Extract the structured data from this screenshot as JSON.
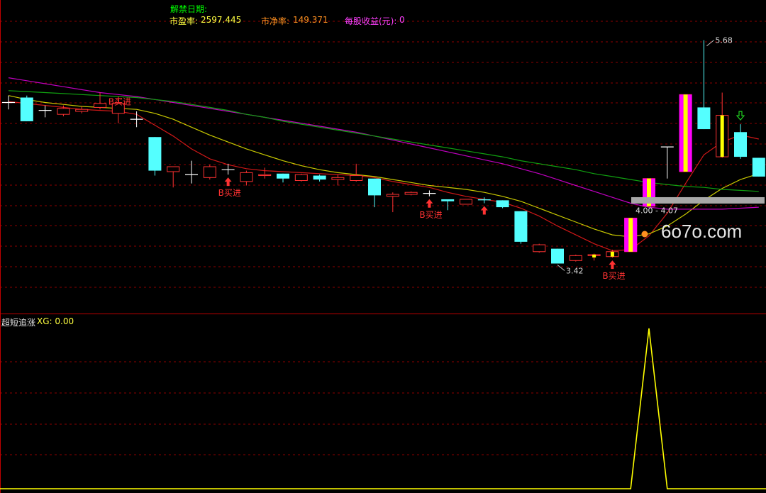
{
  "header": {
    "unlock_date_label": "解禁日期:",
    "pe_label": "市盈率:",
    "pe_value": "2597.445",
    "pb_label": "市净率:",
    "pb_value": "149.371",
    "eps_label": "每股收益(元):",
    "eps_value": "0"
  },
  "indicator": {
    "name": "超短追涨",
    "xg_label": "XG: 0.00"
  },
  "annotations": {
    "high_label": "5.68",
    "low_label": "3.42",
    "range_label": "4.00 - 4.07",
    "buy_label": "B买进"
  },
  "watermark": "6o7o.com",
  "colors": {
    "bg": "#000000",
    "grid": "#8c0000",
    "up_candle": "#ff3232",
    "down_candle": "#54ffff",
    "ma_red": "#d01818",
    "ma_yellow": "#c8c800",
    "ma_magenta": "#c000c0",
    "ma_green": "#10a010",
    "signal_magenta": "#ff00ff",
    "signal_yellow": "#ffff00",
    "buy_text": "#ff3232",
    "label_green": "#00ff00",
    "label_yellow": "#ffff40",
    "label_orange": "#ff9020",
    "label_magenta": "#ff40ff"
  },
  "chart_data": [
    {
      "type": "candlestick",
      "title": "",
      "ylim": [
        3.0,
        5.8
      ],
      "candles": [
        {
          "o": 5.05,
          "c": 5.05,
          "h": 5.12,
          "l": 4.98,
          "dir": "flat"
        },
        {
          "o": 5.1,
          "c": 4.86,
          "h": 5.12,
          "l": 4.86,
          "dir": "down"
        },
        {
          "o": 4.97,
          "c": 4.97,
          "h": 5.02,
          "l": 4.9,
          "dir": "flat"
        },
        {
          "o": 4.93,
          "c": 4.99,
          "h": 5.02,
          "l": 4.91,
          "dir": "up"
        },
        {
          "o": 4.96,
          "c": 4.98,
          "h": 5.01,
          "l": 4.94,
          "dir": "up"
        },
        {
          "o": 5.0,
          "c": 5.04,
          "h": 5.15,
          "l": 4.98,
          "dir": "up"
        },
        {
          "o": 4.94,
          "c": 5.04,
          "h": 5.11,
          "l": 4.84,
          "dir": "up"
        },
        {
          "o": 4.88,
          "c": 4.88,
          "h": 4.96,
          "l": 4.8,
          "dir": "flat"
        },
        {
          "o": 4.7,
          "c": 4.36,
          "h": 4.7,
          "l": 4.31,
          "dir": "down"
        },
        {
          "o": 4.35,
          "c": 4.4,
          "h": 4.4,
          "l": 4.19,
          "dir": "up"
        },
        {
          "o": 4.32,
          "c": 4.32,
          "h": 4.46,
          "l": 4.23,
          "dir": "flat"
        },
        {
          "o": 4.29,
          "c": 4.4,
          "h": 4.42,
          "l": 4.27,
          "dir": "up"
        },
        {
          "o": 4.37,
          "c": 4.37,
          "h": 4.43,
          "l": 4.32,
          "dir": "flat"
        },
        {
          "o": 4.25,
          "c": 4.34,
          "h": 4.36,
          "l": 4.21,
          "dir": "up"
        },
        {
          "o": 4.31,
          "c": 4.32,
          "h": 4.39,
          "l": 4.28,
          "dir": "up"
        },
        {
          "o": 4.33,
          "c": 4.28,
          "h": 4.33,
          "l": 4.24,
          "dir": "down"
        },
        {
          "o": 4.26,
          "c": 4.32,
          "h": 4.33,
          "l": 4.25,
          "dir": "up"
        },
        {
          "o": 4.31,
          "c": 4.27,
          "h": 4.32,
          "l": 4.25,
          "dir": "down"
        },
        {
          "o": 4.27,
          "c": 4.29,
          "h": 4.32,
          "l": 4.21,
          "dir": "up"
        },
        {
          "o": 4.26,
          "c": 4.31,
          "h": 4.43,
          "l": 4.25,
          "dir": "up"
        },
        {
          "o": 4.28,
          "c": 4.11,
          "h": 4.28,
          "l": 3.99,
          "dir": "down"
        },
        {
          "o": 4.1,
          "c": 4.12,
          "h": 4.14,
          "l": 3.94,
          "dir": "up"
        },
        {
          "o": 4.12,
          "c": 4.14,
          "h": 4.15,
          "l": 4.11,
          "dir": "up"
        },
        {
          "o": 4.13,
          "c": 4.13,
          "h": 4.16,
          "l": 4.1,
          "dir": "flat"
        },
        {
          "o": 4.07,
          "c": 4.05,
          "h": 4.07,
          "l": 3.96,
          "dir": "down"
        },
        {
          "o": 4.02,
          "c": 4.07,
          "h": 4.07,
          "l": 4.02,
          "dir": "up"
        },
        {
          "o": 4.07,
          "c": 4.06,
          "h": 4.09,
          "l": 4.03,
          "dir": "down"
        },
        {
          "o": 4.06,
          "c": 3.99,
          "h": 4.06,
          "l": 3.98,
          "dir": "down"
        },
        {
          "o": 3.95,
          "c": 3.64,
          "h": 3.95,
          "l": 3.62,
          "dir": "down"
        },
        {
          "o": 3.54,
          "c": 3.61,
          "h": 3.62,
          "l": 3.53,
          "dir": "up"
        },
        {
          "o": 3.57,
          "c": 3.42,
          "h": 3.57,
          "l": 3.42,
          "dir": "down"
        },
        {
          "o": 3.45,
          "c": 3.5,
          "h": 3.51,
          "l": 3.44,
          "dir": "up"
        },
        {
          "o": 3.5,
          "c": 3.51,
          "h": 3.52,
          "l": 3.45,
          "dir": "up",
          "sig": "yellow"
        },
        {
          "o": 3.49,
          "c": 3.54,
          "h": 3.56,
          "l": 3.48,
          "dir": "up",
          "sig": "yellow"
        },
        {
          "o": 3.54,
          "c": 3.88,
          "h": 3.88,
          "l": 3.54,
          "dir": "up",
          "sig": "magenta"
        },
        {
          "o": 4.0,
          "c": 4.28,
          "h": 4.28,
          "l": 4.0,
          "dir": "up",
          "sig": "magenta"
        },
        {
          "o": 4.6,
          "c": 4.6,
          "h": 4.6,
          "l": 4.28,
          "dir": "flat"
        },
        {
          "o": 4.35,
          "c": 5.13,
          "h": 5.13,
          "l": 4.35,
          "dir": "up",
          "sig": "magenta"
        },
        {
          "o": 5.0,
          "c": 4.78,
          "h": 5.68,
          "l": 4.78,
          "dir": "down"
        },
        {
          "o": 4.92,
          "c": 4.5,
          "h": 5.15,
          "l": 4.49,
          "dir": "up",
          "sig": "yellow"
        },
        {
          "o": 4.75,
          "c": 4.5,
          "h": 4.83,
          "l": 4.48,
          "dir": "down"
        },
        {
          "o": 4.49,
          "c": 4.3,
          "h": 4.49,
          "l": 4.3,
          "dir": "down"
        }
      ],
      "ma_series": [
        {
          "color_key": "ma_red",
          "values": [
            5.06,
            5.04,
            5.02,
            5.0,
            4.98,
            4.97,
            4.96,
            4.93,
            4.82,
            4.71,
            4.58,
            4.48,
            4.42,
            4.38,
            4.36,
            4.35,
            4.34,
            4.33,
            4.32,
            4.31,
            4.29,
            4.25,
            4.22,
            4.19,
            4.14,
            4.1,
            4.07,
            4.04,
            3.98,
            3.9,
            3.8,
            3.71,
            3.62,
            3.55,
            3.56,
            3.7,
            3.93,
            4.23,
            4.52,
            4.65,
            4.72,
            4.68
          ]
        },
        {
          "color_key": "ma_yellow",
          "values": [
            5.12,
            5.08,
            5.05,
            5.03,
            5.01,
            5.0,
            4.99,
            4.98,
            4.94,
            4.88,
            4.8,
            4.72,
            4.65,
            4.58,
            4.52,
            4.46,
            4.41,
            4.37,
            4.34,
            4.32,
            4.3,
            4.27,
            4.24,
            4.21,
            4.19,
            4.17,
            4.14,
            4.1,
            4.05,
            3.98,
            3.91,
            3.84,
            3.77,
            3.71,
            3.69,
            3.72,
            3.8,
            3.92,
            4.06,
            4.18,
            4.27,
            4.33
          ]
        },
        {
          "color_key": "ma_magenta",
          "values": [
            5.3,
            5.27,
            5.24,
            5.21,
            5.18,
            5.15,
            5.13,
            5.11,
            5.08,
            5.05,
            5.02,
            4.99,
            4.96,
            4.93,
            4.9,
            4.87,
            4.84,
            4.81,
            4.78,
            4.75,
            4.71,
            4.67,
            4.63,
            4.59,
            4.55,
            4.51,
            4.47,
            4.43,
            4.38,
            4.33,
            4.27,
            4.21,
            4.15,
            4.09,
            4.03,
            3.99,
            3.97,
            3.97,
            3.97,
            3.97,
            3.98,
            3.99
          ]
        },
        {
          "color_key": "ma_green",
          "values": [
            5.17,
            5.16,
            5.15,
            5.14,
            5.13,
            5.12,
            5.11,
            5.1,
            5.08,
            5.06,
            5.03,
            5.0,
            4.97,
            4.93,
            4.9,
            4.86,
            4.83,
            4.8,
            4.77,
            4.74,
            4.71,
            4.68,
            4.65,
            4.62,
            4.59,
            4.56,
            4.53,
            4.5,
            4.46,
            4.43,
            4.4,
            4.37,
            4.33,
            4.3,
            4.27,
            4.24,
            4.22,
            4.2,
            4.19,
            4.17,
            4.16,
            4.15
          ]
        }
      ],
      "buy_signals": [
        {
          "index": 6,
          "arrow": false,
          "label": true
        },
        {
          "index": 12,
          "arrow": true,
          "label": true
        },
        {
          "index": 23,
          "arrow": true,
          "label": true
        },
        {
          "index": 26,
          "arrow": true,
          "label": false
        },
        {
          "index": 33,
          "arrow": true,
          "label": true
        }
      ],
      "sell_signal_index": 40,
      "high_marker": {
        "index": 38,
        "value": 5.68
      },
      "low_marker": {
        "index": 30,
        "value": 3.42
      },
      "price_box": {
        "from": 4.0,
        "to": 4.07
      }
    },
    {
      "type": "line",
      "name": "超短追涨",
      "ylim": [
        0,
        1
      ],
      "values": [
        0,
        0,
        0,
        0,
        0,
        0,
        0,
        0,
        0,
        0,
        0,
        0,
        0,
        0,
        0,
        0,
        0,
        0,
        0,
        0,
        0,
        0,
        0,
        0,
        0,
        0,
        0,
        0,
        0,
        0,
        0,
        0,
        0,
        0,
        0,
        1,
        0,
        0,
        0,
        0,
        0,
        0
      ]
    }
  ]
}
